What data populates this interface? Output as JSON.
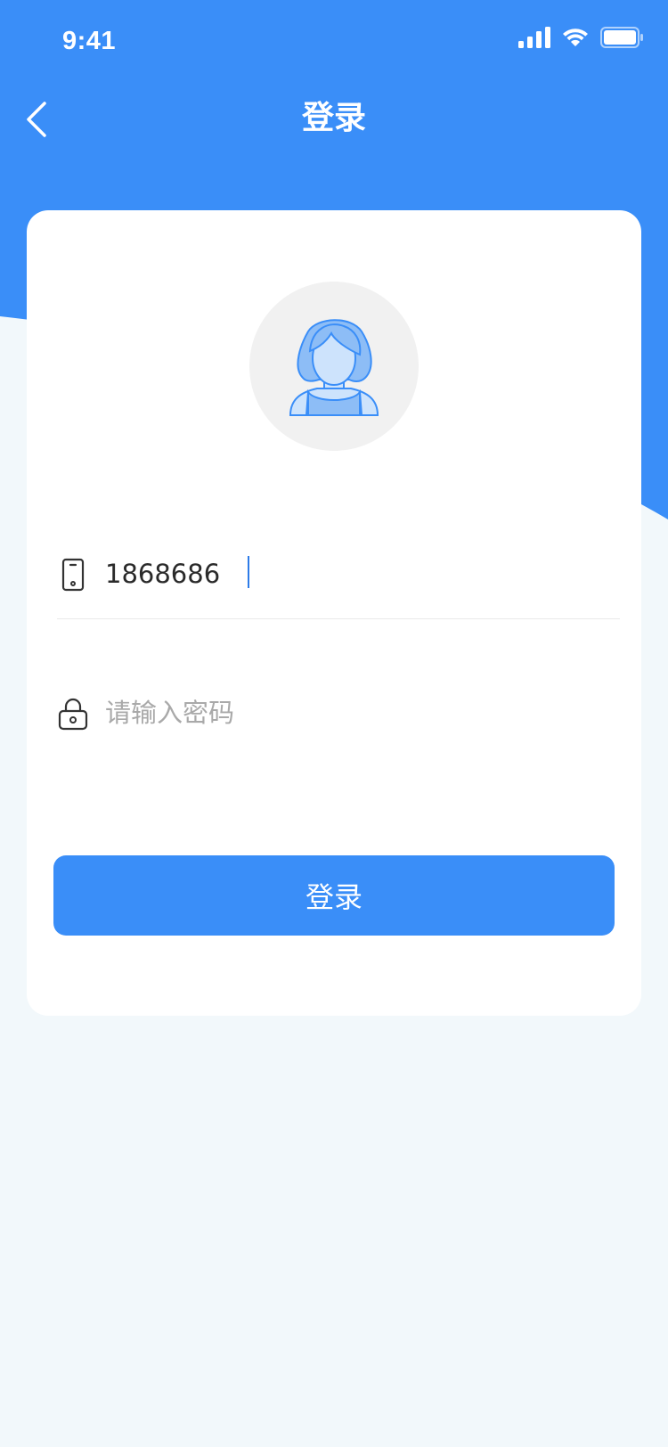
{
  "status_bar": {
    "time": "9:41"
  },
  "nav": {
    "title": "登录"
  },
  "form": {
    "phone_value": "1868686",
    "password_placeholder": "请输入密码"
  },
  "login_button": {
    "label": "登录"
  },
  "colors": {
    "primary": "#3a8ef8",
    "page_background": "#f2f8fb",
    "card": "#ffffff",
    "caret": "#2d7be8"
  },
  "icons": {
    "back": "chevron-left-icon",
    "phone": "mobile-phone-icon",
    "password": "lock-icon",
    "avatar": "female-avatar-icon",
    "signal": "signal-icon",
    "wifi": "wifi-icon",
    "battery": "battery-icon"
  }
}
